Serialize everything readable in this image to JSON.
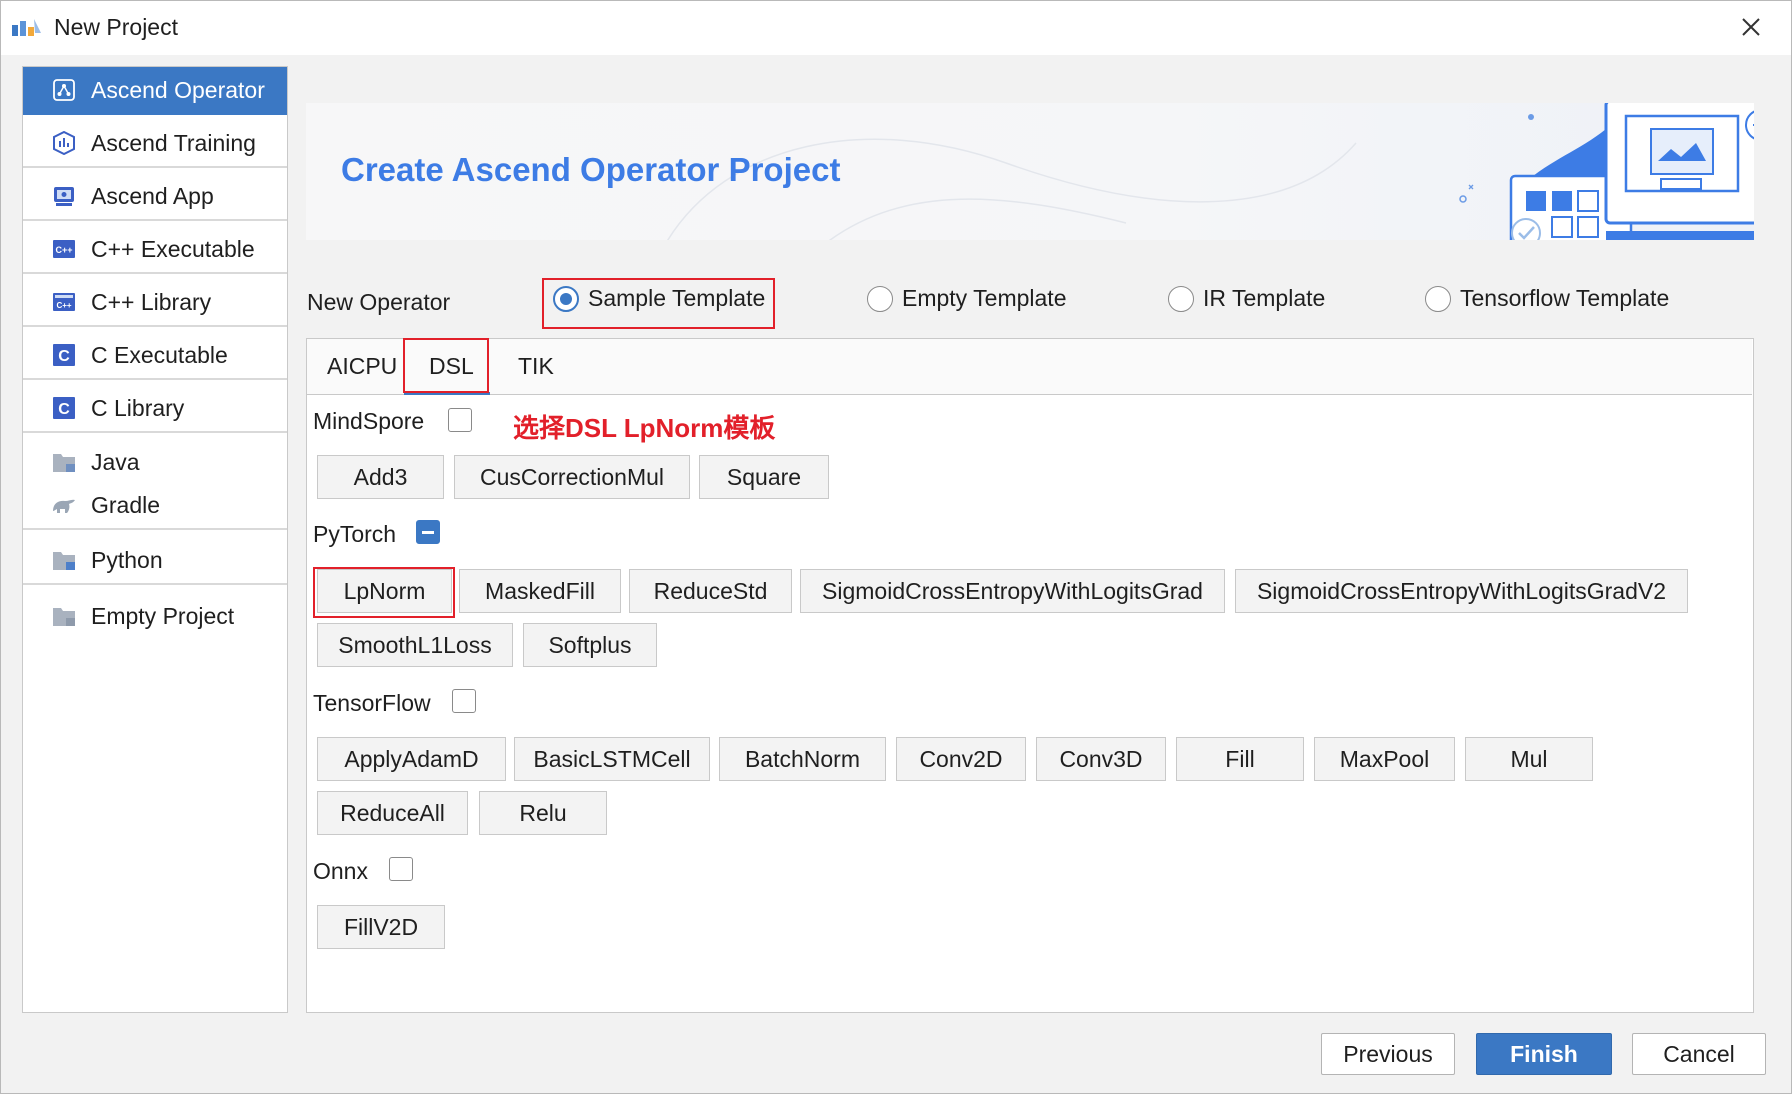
{
  "window": {
    "title": "New Project"
  },
  "sidebar": {
    "items": [
      {
        "label": "Ascend Operator",
        "icon": "operator-icon"
      },
      {
        "label": "Ascend Training",
        "icon": "training-icon"
      },
      {
        "label": "Ascend App",
        "icon": "app-icon"
      },
      {
        "label": "C++ Executable",
        "icon": "cpp-executable-icon"
      },
      {
        "label": "C++ Library",
        "icon": "cpp-library-icon"
      },
      {
        "label": "C Executable",
        "icon": "c-executable-icon"
      },
      {
        "label": "C Library",
        "icon": "c-library-icon"
      },
      {
        "label": "Java",
        "icon": "folder-icon"
      },
      {
        "label": "Gradle",
        "icon": "gradle-icon"
      },
      {
        "label": "Python",
        "icon": "folder-icon"
      },
      {
        "label": "Empty Project",
        "icon": "folder-icon"
      }
    ],
    "selected": "Ascend Operator"
  },
  "banner": {
    "title": "Create Ascend Operator Project"
  },
  "new_operator": {
    "label": "New Operator",
    "options": [
      "Sample Template",
      "Empty Template",
      "IR Template",
      "Tensorflow Template"
    ],
    "selected": "Sample Template"
  },
  "tabs": {
    "items": [
      "AICPU",
      "DSL",
      "TIK"
    ],
    "selected": "DSL"
  },
  "annotation": "选择DSL LpNorm模板",
  "frameworks": {
    "mindspore": {
      "label": "MindSpore",
      "checked": false,
      "ops": [
        "Add3",
        "CusCorrectionMul",
        "Square"
      ]
    },
    "pytorch": {
      "label": "PyTorch",
      "checked": "partial",
      "ops": [
        "LpNorm",
        "MaskedFill",
        "ReduceStd",
        "SigmoidCrossEntropyWithLogitsGrad",
        "SigmoidCrossEntropyWithLogitsGradV2",
        "SmoothL1Loss",
        "Softplus"
      ]
    },
    "tensorflow": {
      "label": "TensorFlow",
      "checked": false,
      "ops": [
        "ApplyAdamD",
        "BasicLSTMCell",
        "BatchNorm",
        "Conv2D",
        "Conv3D",
        "Fill",
        "MaxPool",
        "Mul",
        "ReduceAll",
        "Relu"
      ]
    },
    "onnx": {
      "label": "Onnx",
      "checked": false,
      "ops": [
        "FillV2D"
      ]
    }
  },
  "footer": {
    "previous": "Previous",
    "finish": "Finish",
    "cancel": "Cancel"
  },
  "colors": {
    "accent": "#3b78c4",
    "banner_title": "#3d7ce5",
    "highlight": "#e2202a"
  }
}
